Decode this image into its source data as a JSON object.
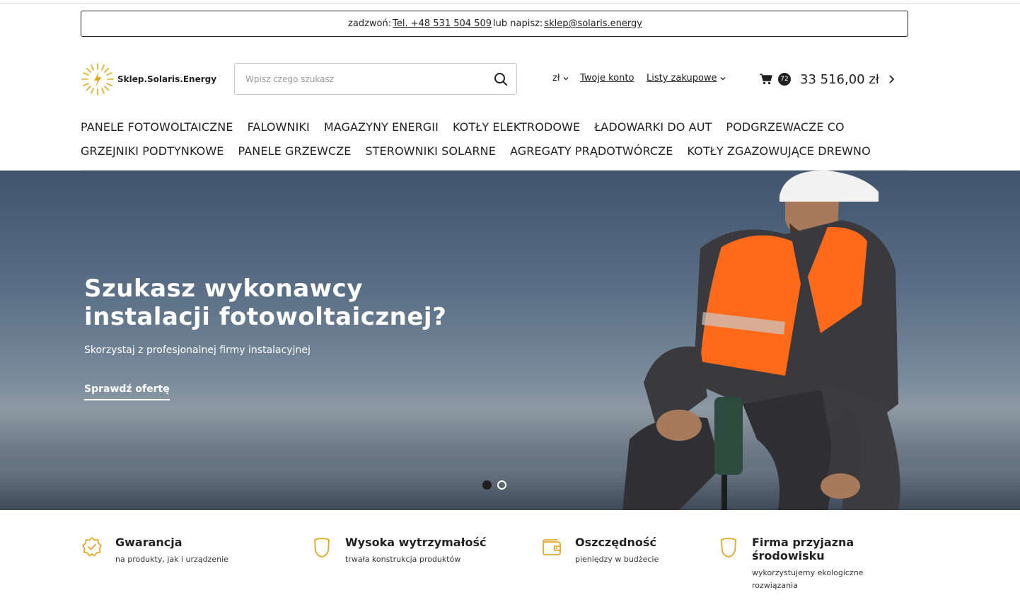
{
  "contact": {
    "prefix": "zadzwoń:",
    "phone": "Tel. +48 531 504 509",
    "middle": "lub napisz:",
    "email": "sklep@solaris.energy"
  },
  "logo": {
    "text": "Sklep.Solaris.Energy"
  },
  "search": {
    "placeholder": "Wpisz czego szukasz"
  },
  "header": {
    "currency": "zł",
    "account": "Twoje konto",
    "lists": "Listy zakupowe",
    "cart_count": "72",
    "cart_total": "33 516,00 zł"
  },
  "nav": {
    "row1": [
      "PANELE FOTOWOLTAICZNE",
      "FALOWNIKI",
      "MAGAZYNY ENERGII",
      "KOTŁY ELEKTRODOWE",
      "ŁADOWARKI DO AUT",
      "PODGRZEWACZE CO"
    ],
    "row2": [
      "GRZEJNIKI PODTYNKOWE",
      "PANELE GRZEWCZE",
      "STEROWNIKI SOLARNE",
      "AGREGATY PRĄDOTWÓRCZE",
      "KOTŁY ZGAZOWUJĄCE DREWNO"
    ]
  },
  "hero": {
    "title_line1": "Szukasz wykonawcy",
    "title_line2": "instalacji fotowoltaicznej?",
    "subtitle": "Skorzystaj z profesjonalnej firmy instalacyjnej",
    "cta": "Sprawdź ofertę",
    "slides_total": 2,
    "active_slide": 1
  },
  "features": [
    {
      "icon": "badge-check-icon",
      "title": "Gwarancja",
      "desc": "na produkty, jak i urządzenie"
    },
    {
      "icon": "shield-icon",
      "title": "Wysoka wytrzymałość",
      "desc": "trwała konstrukcja produktów"
    },
    {
      "icon": "wallet-icon",
      "title": "Oszczędność",
      "desc": "pieniędzy w budżecie"
    },
    {
      "icon": "shield-icon",
      "title": "Firma przyjazna środowisku",
      "desc": "wykorzystujemy ekologiczne rozwiązania"
    }
  ],
  "colors": {
    "accent": "#e5a823",
    "dark": "#1f1f1f"
  }
}
